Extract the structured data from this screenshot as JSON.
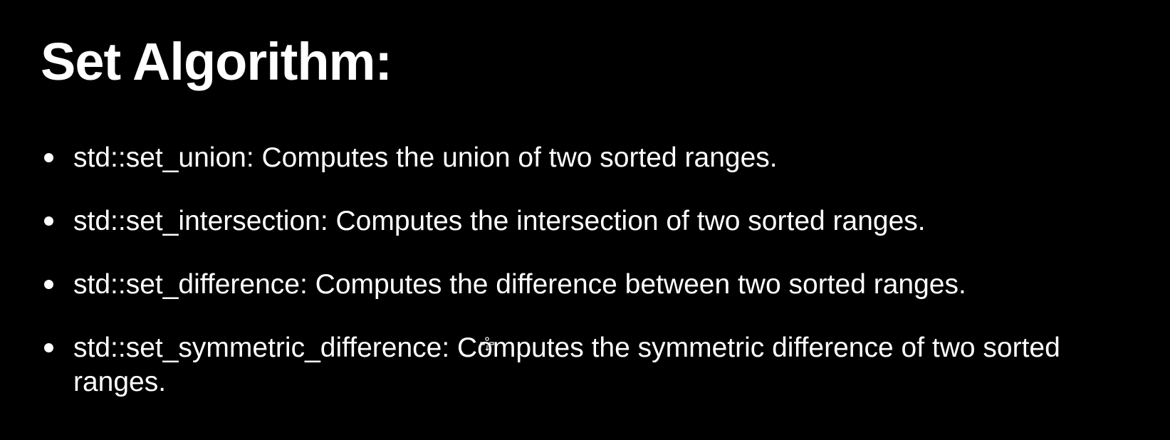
{
  "slide": {
    "title": "Set Algorithm:",
    "bullets": [
      {
        "text": "std::set_union: Computes the union of two sorted ranges."
      },
      {
        "text": "std::set_intersection: Computes the intersection of two sorted ranges."
      },
      {
        "text": "std::set_difference: Computes the difference between two sorted ranges."
      },
      {
        "text": "std::set_symmetric_difference: Computes the symmetric difference of two sorted ranges."
      }
    ]
  },
  "colors": {
    "background": "#000000",
    "text": "#ffffff"
  },
  "icons": {
    "cursor": "move-cursor-icon",
    "bullet": "bullet-dot-icon"
  }
}
